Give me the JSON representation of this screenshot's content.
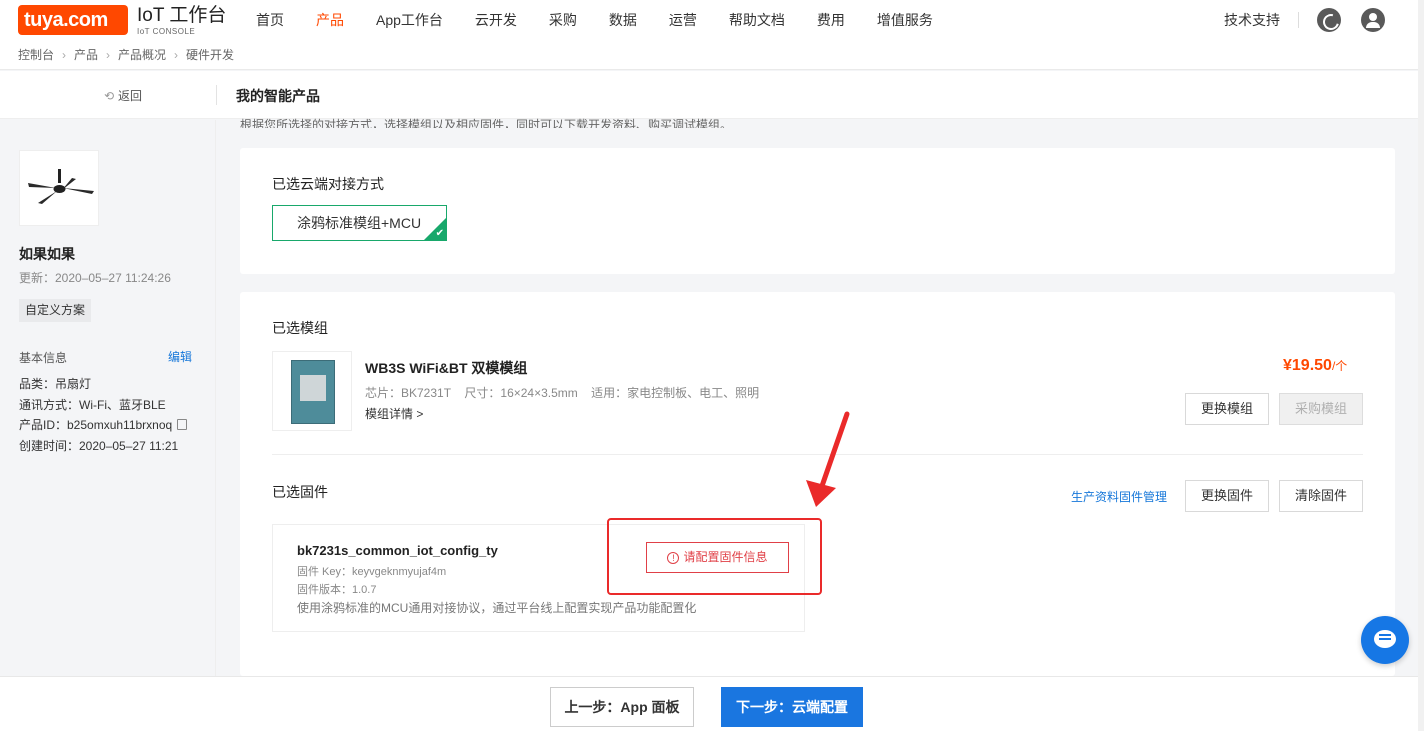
{
  "header": {
    "logo_text": "tuya.com",
    "brand_title": "IoT 工作台",
    "brand_sub": "IoT CONSOLE",
    "nav": [
      "首页",
      "产品",
      "App工作台",
      "云开发",
      "采购",
      "数据",
      "运营",
      "帮助文档",
      "费用",
      "增值服务"
    ],
    "active_nav": "产品",
    "support": "技术支持"
  },
  "breadcrumb": [
    "控制台",
    "产品",
    "产品概况",
    "硬件开发"
  ],
  "subheader": {
    "back": "返回",
    "title": "我的智能产品"
  },
  "product": {
    "name": "如果如果",
    "updated": "更新：2020–05–27 11:24:26",
    "tag": "自定义方案",
    "info_heading": "基本信息",
    "edit": "编辑",
    "category": "品类：吊扇灯",
    "protocol": "通讯方式：Wi-Fi、蓝牙BLE",
    "product_id": "产品ID：b25omxuh11brxnoq",
    "created": "创建时间：2020–05–27 11:21"
  },
  "intro": "根据您所选择的对接方式，选择模组以及相应固件，同时可以下载开发资料、购买调试模组。",
  "cloud": {
    "title": "已选云端对接方式",
    "selected": "涂鸦标准模组+MCU"
  },
  "module": {
    "section_title": "已选模组",
    "name": "WB3S WiFi&BT 双模模组",
    "chip": "芯片：BK7231T",
    "size": "尺寸：16×24×3.5mm",
    "usage": "适用：家电控制板、电工、照明",
    "details_link": "模组详情 >",
    "price": "¥19.50",
    "price_unit": "/个",
    "change_btn": "更换模组",
    "buy_btn": "采购模组"
  },
  "firmware": {
    "section_title": "已选固件",
    "manage_link": "生产资料固件管理",
    "change_btn": "更换固件",
    "clear_btn": "清除固件",
    "name": "bk7231s_common_iot_config_ty",
    "key": "固件 Key：keyvgeknmyujaf4m",
    "version": "固件版本：1.0.7",
    "description": "使用涂鸦标准的MCU通用对接协议，通过平台线上配置实现产品功能配置化",
    "config_btn": "请配置固件信息"
  },
  "footer": {
    "prev": "上一步：App 面板",
    "next": "下一步：云端配置"
  },
  "colors": {
    "brand_orange": "#ff4800",
    "primary_blue": "#1a76e0",
    "success_green": "#18a86b",
    "alert_red": "#e04047",
    "annotation_red": "#ea2a2a"
  }
}
